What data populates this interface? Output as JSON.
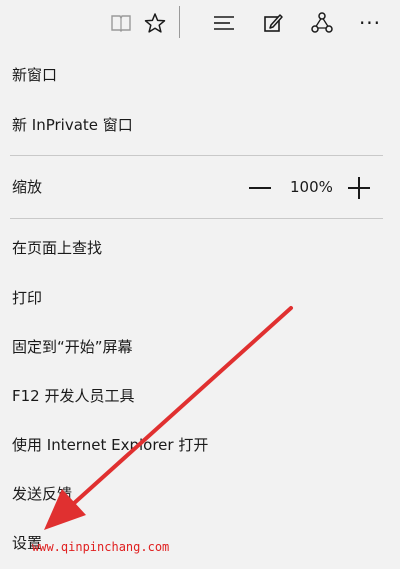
{
  "toolbar": {
    "icons": [
      "reading-view-icon",
      "favorite-star-icon",
      "hub-icon",
      "web-note-icon",
      "share-icon",
      "more-icon"
    ],
    "more_glyph": "···"
  },
  "menu": {
    "new_window": "新窗口",
    "new_inprivate": "新 InPrivate 窗口",
    "zoom_label": "缩放",
    "zoom_value": "100%",
    "find": "在页面上查找",
    "print": "打印",
    "pin_start": "固定到“开始”屏幕",
    "f12": "F12 开发人员工具",
    "open_ie": "使用 Internet Explorer 打开",
    "feedback": "发送反馈",
    "settings": "设置"
  },
  "watermark": "www.qinpinchang.com",
  "colors": {
    "background": "#f2f2f2",
    "arrow": "#e03030",
    "watermark": "#e02020"
  }
}
